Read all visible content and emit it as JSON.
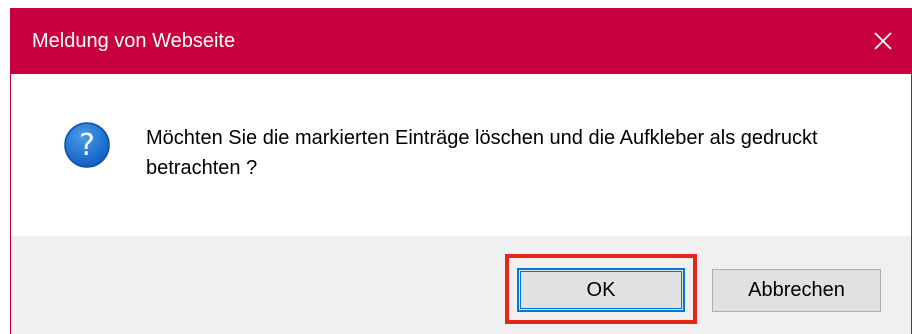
{
  "window": {
    "title": "Meldung von Webseite",
    "close_icon": "close-icon",
    "accent_color": "#c8003f"
  },
  "content": {
    "icon": "question-icon",
    "icon_glyph": "?",
    "message": "Möchten Sie die markierten Einträge löschen und die Aufkleber als gedruckt betrachten ?"
  },
  "buttons": {
    "ok_label": "OK",
    "cancel_label": "Abbrechen",
    "ok_highlight_color": "#e5261d"
  }
}
